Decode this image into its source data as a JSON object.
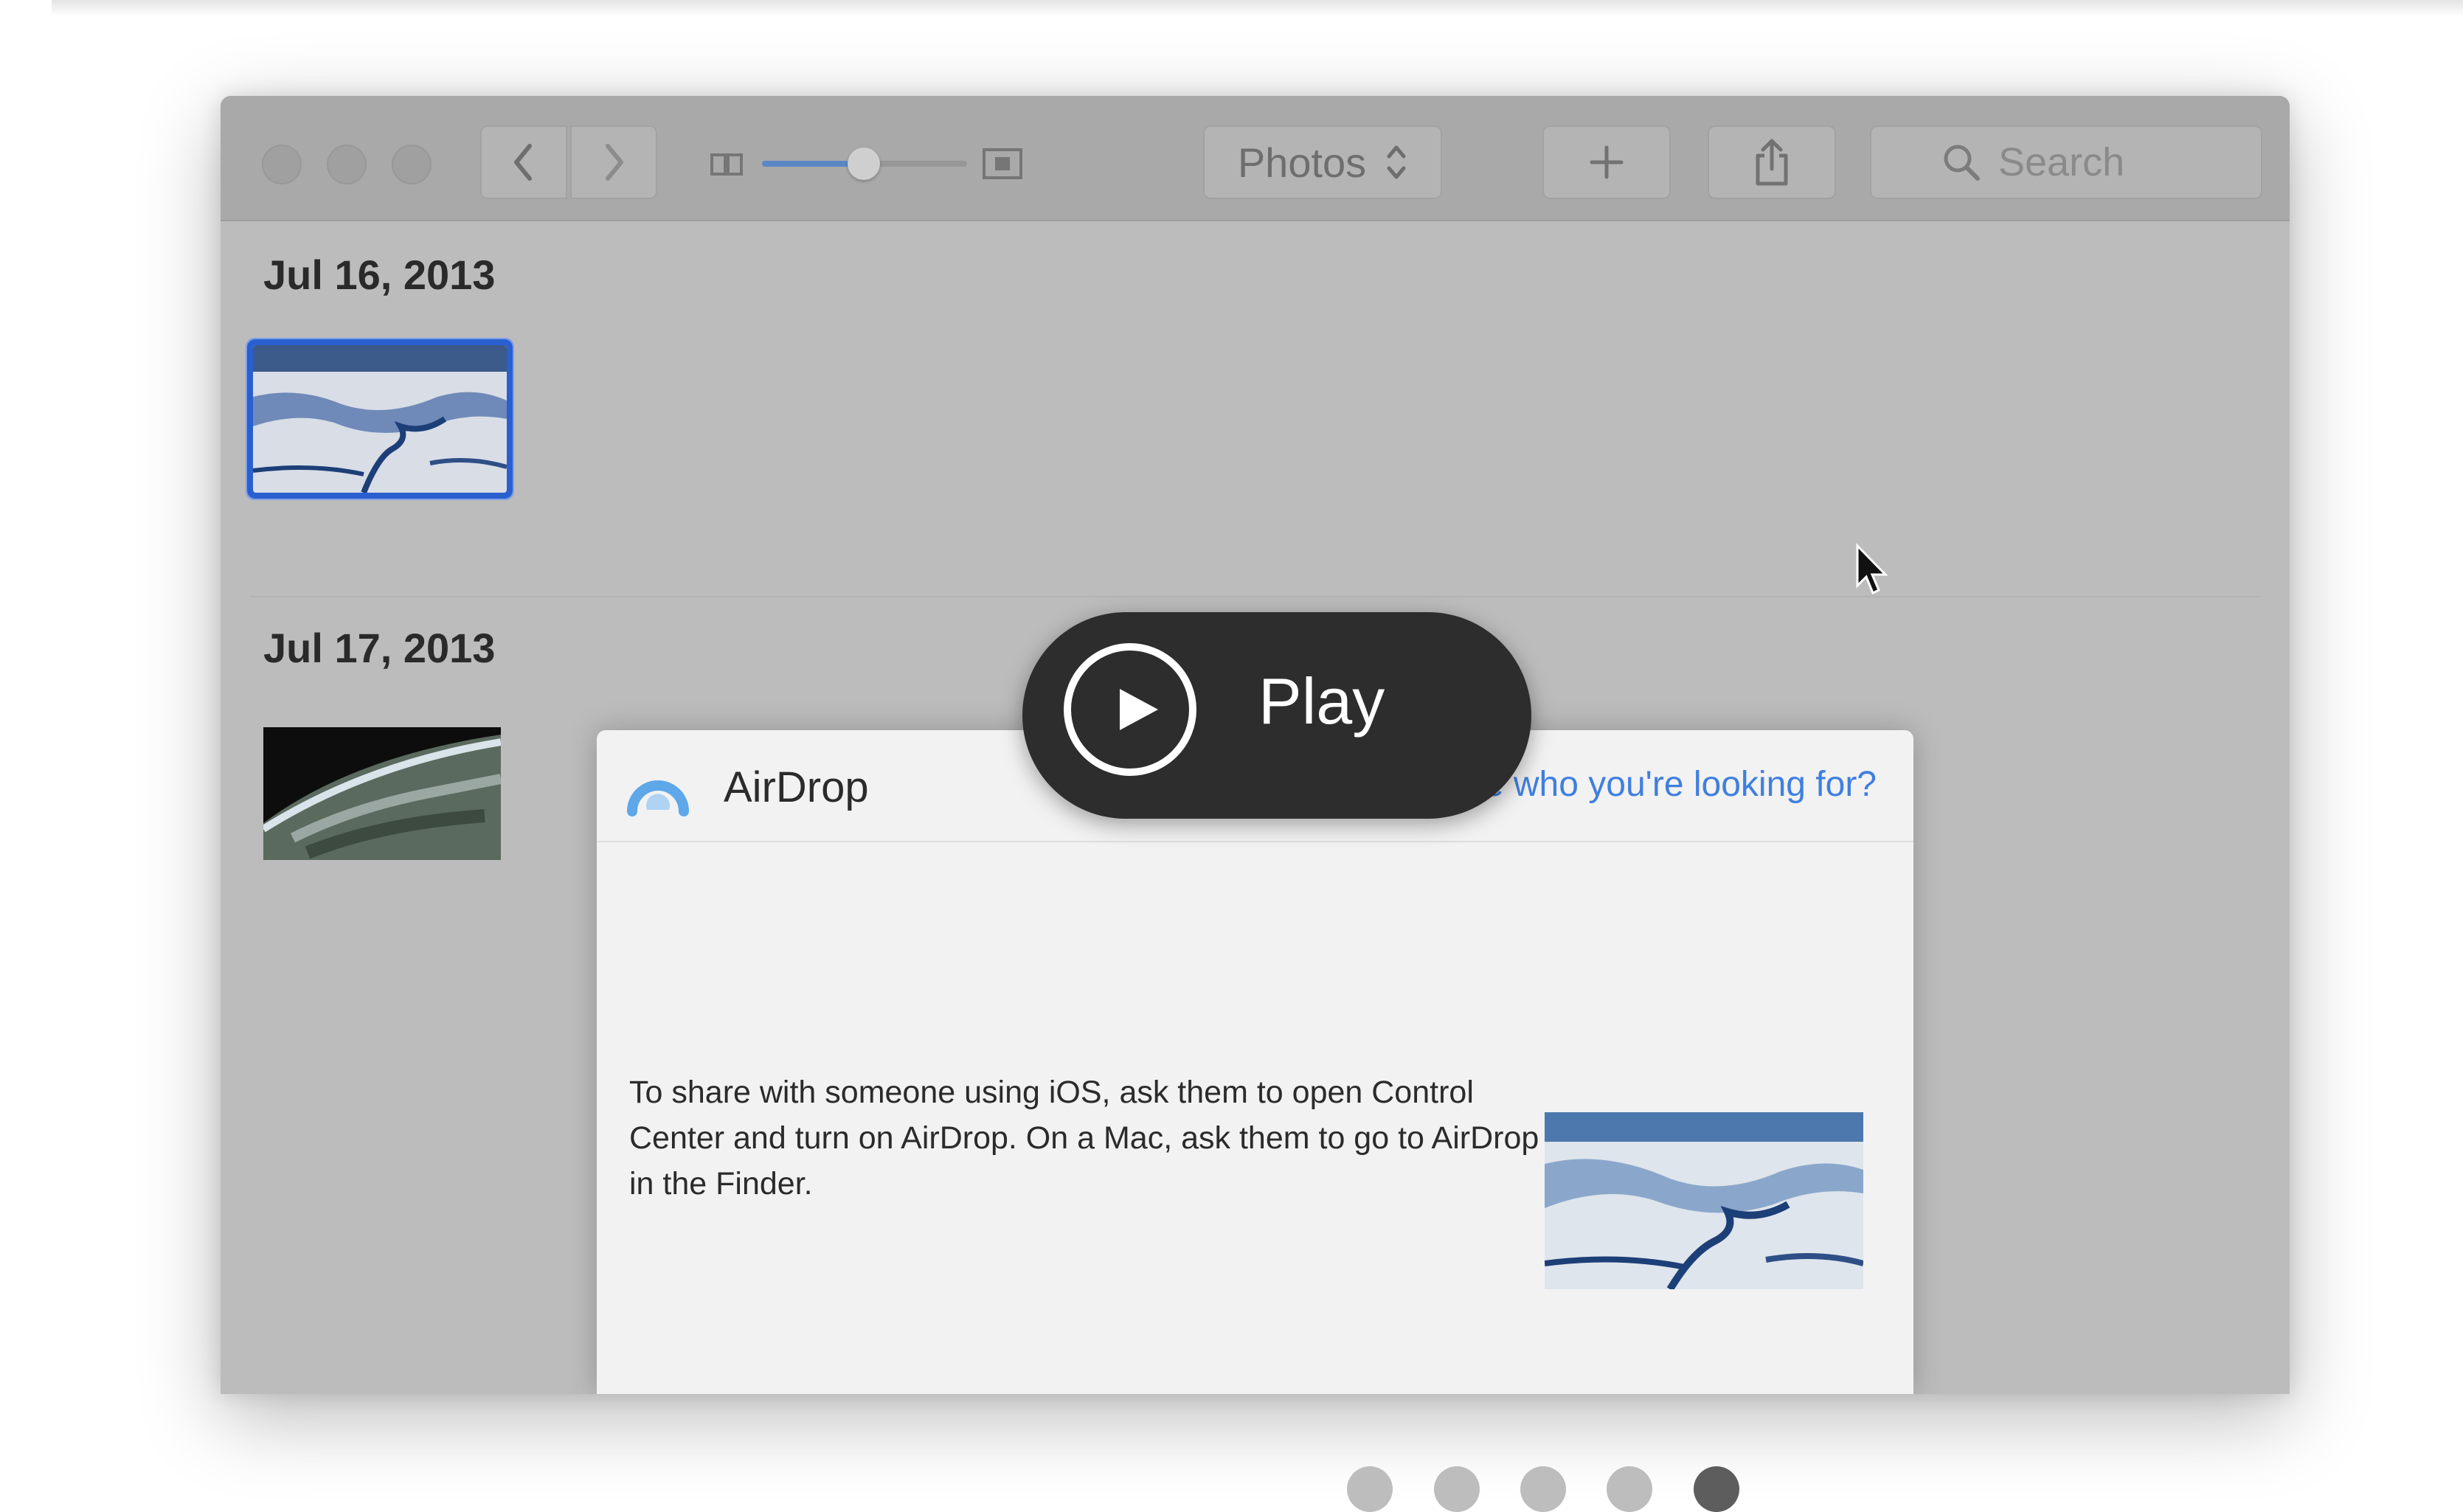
{
  "window": {
    "source_popup": "Photos",
    "search_placeholder": "Search"
  },
  "dates": [
    "Jul 16, 2013",
    "Jul 17, 2013"
  ],
  "airdrop": {
    "title": "AirDrop",
    "help_link": "Don't see who you're looking for?",
    "instructions": "To share with someone using iOS, ask them to open Control Center and turn on AirDrop. On a Mac, ask them to go to AirDrop in the Finder."
  },
  "overlay": {
    "play_label": "Play"
  },
  "carousel": {
    "page_count": 5,
    "active_index": 4
  },
  "icons": {
    "back": "chevron-left-icon",
    "forward": "chevron-right-icon",
    "add": "plus-icon",
    "share": "share-icon",
    "search": "search-icon",
    "airdrop": "airdrop-icon",
    "play": "play-icon"
  },
  "colors": {
    "selection": "#2a5fd0",
    "link": "#3f7fe0",
    "slider_fill": "#5b87c6",
    "active_dot": "#5d5d5d",
    "inactive_dot": "#bdbdbd"
  }
}
